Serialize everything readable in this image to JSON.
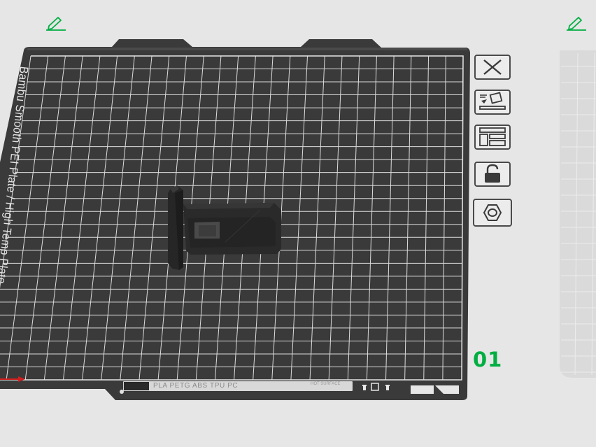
{
  "plate": {
    "name_label": "Bambu Smooth PEI Plate / High Temp Plate",
    "number": "01",
    "strip_text": "PLA  PETG  ABS  TPU  PC",
    "strip_hot": "HOT SURFACE"
  },
  "toolbar": {
    "icons": [
      "close-icon",
      "auto-orient-icon",
      "arrange-icon",
      "lock-icon",
      "plate-settings-icon"
    ]
  },
  "colors": {
    "background": "#e6e6e6",
    "plate": "#3b3b3b",
    "grid": "#d9d9d9",
    "accent": "#00ae42",
    "object": "#222222",
    "x_axis": "#d21f1f"
  }
}
